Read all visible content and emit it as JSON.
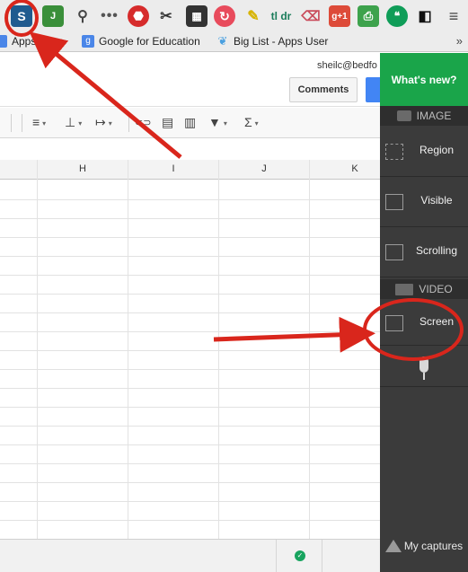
{
  "extensions": [
    {
      "name": "screencastify",
      "glyph": "S"
    },
    {
      "name": "green-extension",
      "glyph": "J"
    },
    {
      "name": "lamp",
      "glyph": "⚲"
    },
    {
      "name": "more-dots",
      "glyph": "•••"
    },
    {
      "name": "stop",
      "glyph": "⬣"
    },
    {
      "name": "tools",
      "glyph": "✂"
    },
    {
      "name": "film",
      "glyph": "▦"
    },
    {
      "name": "refresh",
      "glyph": "↻"
    },
    {
      "name": "highlighter",
      "glyph": "✎"
    },
    {
      "name": "tldr",
      "glyph": "tl dr"
    },
    {
      "name": "eraser",
      "glyph": "⌫"
    },
    {
      "name": "google-plus-one",
      "glyph": "g+1"
    },
    {
      "name": "print-friendly",
      "glyph": "⎙"
    },
    {
      "name": "hangouts",
      "glyph": "❝"
    },
    {
      "name": "window",
      "glyph": "◧"
    },
    {
      "name": "chrome-menu",
      "glyph": "≡"
    }
  ],
  "bookmarks": {
    "items": [
      {
        "label": "Apps Sites",
        "icon": ""
      },
      {
        "label": "Google for Education",
        "icon": "g"
      },
      {
        "label": "Big List - Apps User",
        "icon": "❦"
      }
    ],
    "more": "»"
  },
  "header": {
    "user": "sheilc@bedfo",
    "comments_label": "Comments"
  },
  "toolbar": {
    "align": "≡",
    "valign": "⊥",
    "wrap": "↦",
    "link": "⊂⊃",
    "comment": "▤",
    "chart": "▥",
    "filter": "▼",
    "functions": "Σ",
    "caret": "▾"
  },
  "grid": {
    "columns": [
      "H",
      "I",
      "J",
      "K"
    ]
  },
  "status": {
    "ok": "✓"
  },
  "panel": {
    "whats_new": "What's new?",
    "image_header": "IMAGE",
    "video_header": "VIDEO",
    "image_items": [
      "Region",
      "Visible",
      "Scrolling"
    ],
    "video_items": [
      "Screen"
    ],
    "my_captures": "My captures",
    "bg_color": "#3b3b3b",
    "accent_color": "#1aa54a"
  },
  "annotations": {
    "color": "#d9261c"
  }
}
